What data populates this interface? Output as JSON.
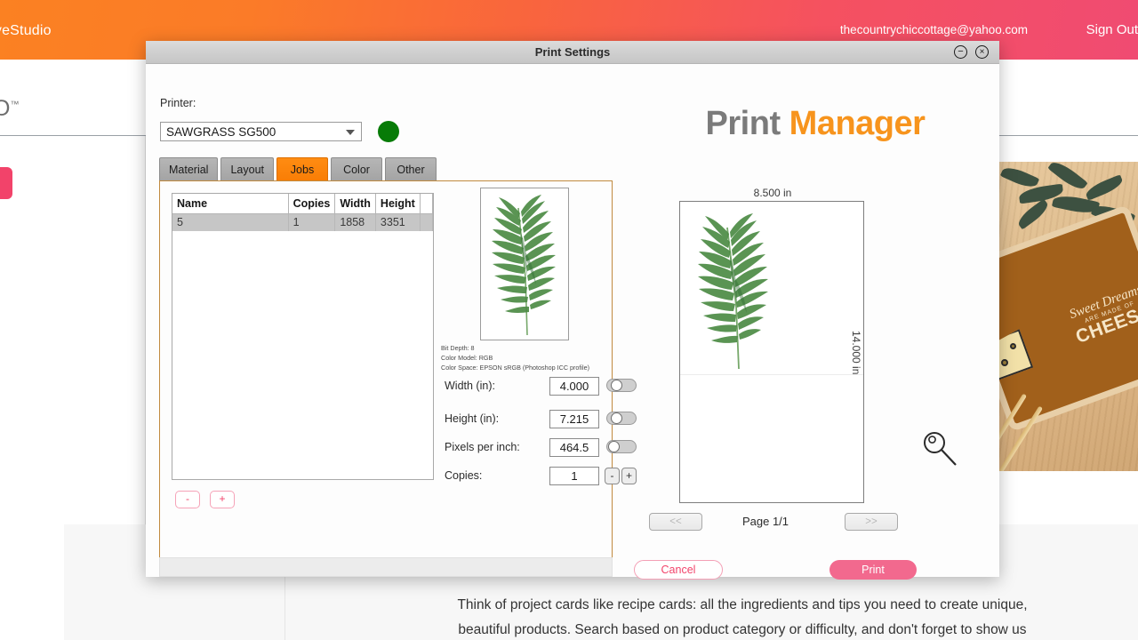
{
  "background": {
    "brand": "CreativeStudio",
    "account_email": "thecountrychiccottage@yahoo.com",
    "sign_out": "Sign Out",
    "logo_text": "O",
    "logo_tm": "™",
    "photo": {
      "line1": "Sweet Dreams",
      "line2": "ARE MADE OF",
      "line3": "CHEESE"
    },
    "body_line1": "Think of project cards like recipe cards: all the ingredients and tips you need to create unique,",
    "body_line2": "beautiful products. Search based on product category or difficulty, and don't forget to show us"
  },
  "dialog": {
    "title": "Print Settings",
    "minimize_icon": "⊖",
    "close_icon": "⊗",
    "printer_label": "Printer:",
    "printer_value": "SAWGRASS SG500",
    "status_color": "#077b07",
    "tabs": [
      {
        "label": "Material",
        "active": false
      },
      {
        "label": "Layout",
        "active": false
      },
      {
        "label": "Jobs",
        "active": true
      },
      {
        "label": "Color",
        "active": false
      },
      {
        "label": "Other",
        "active": false
      }
    ],
    "job_table": {
      "headers": [
        "Name",
        "Copies",
        "Width",
        "Height"
      ],
      "rows": [
        {
          "name": "5",
          "copies": "1",
          "width": "1858",
          "height": "3351"
        }
      ]
    },
    "list_buttons": {
      "remove": "-",
      "add": "+"
    },
    "image_meta": {
      "bit_depth": "Bit Depth: 8",
      "color_model": "Color Model: RGB",
      "color_space": "Color Space: EPSON  sRGB (Photoshop ICC profile)"
    },
    "fields": {
      "width_label": "Width (in):",
      "width_value": "4.000",
      "height_label": "Height (in):",
      "height_value": "7.215",
      "ppi_label": "Pixels per inch:",
      "ppi_value": "464.5",
      "copies_label": "Copies:",
      "copies_value": "1",
      "copies_minus": "-",
      "copies_plus": "+"
    },
    "manager_title": {
      "part1": "Print",
      "part2": "Manager",
      "color1": "#7b7b7b",
      "color2": "#f7941d"
    },
    "preview": {
      "width_dim": "8.500 in",
      "height_dim": "14.000 in",
      "prev_page": "<<",
      "next_page": ">>",
      "page_label": "Page 1/1"
    },
    "cancel_label": "Cancel",
    "print_label": "Print"
  }
}
